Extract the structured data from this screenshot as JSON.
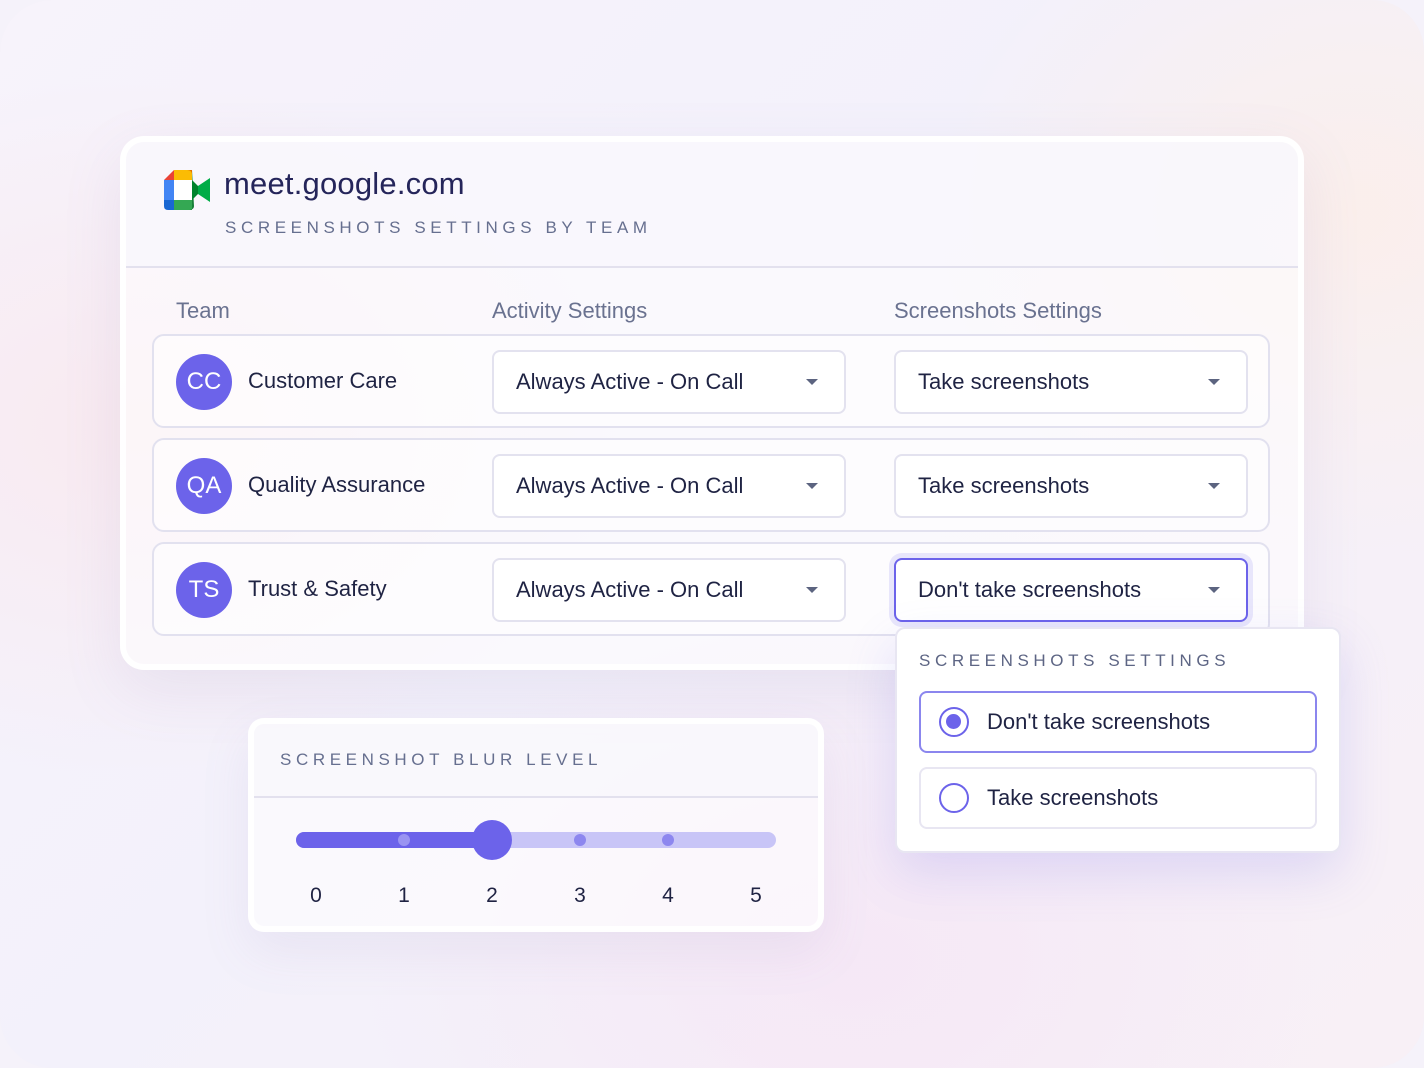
{
  "header": {
    "site": "meet.google.com",
    "subtitle": "SCREENSHOTS SETTINGS BY TEAM",
    "logo_icon": "google-meet-icon"
  },
  "columns": {
    "team": "Team",
    "activity": "Activity Settings",
    "screenshots": "Screenshots Settings"
  },
  "rows": [
    {
      "initials": "CC",
      "name": "Customer Care",
      "activity": "Always Active - On Call",
      "screenshots": "Take screenshots"
    },
    {
      "initials": "QA",
      "name": "Quality Assurance",
      "activity": "Always Active - On Call",
      "screenshots": "Take screenshots"
    },
    {
      "initials": "TS",
      "name": "Trust & Safety",
      "activity": "Always Active - On Call",
      "screenshots": "Don't take screenshots"
    }
  ],
  "dropdown": {
    "title": "SCREENSHOTS SETTINGS",
    "options": [
      {
        "label": "Don't take screenshots",
        "selected": true
      },
      {
        "label": "Take screenshots",
        "selected": false
      }
    ]
  },
  "blur": {
    "title": "SCREENSHOT BLUR LEVEL",
    "levels": [
      "0",
      "1",
      "2",
      "3",
      "4",
      "5"
    ],
    "value": 2,
    "min": 0,
    "max": 5
  },
  "colors": {
    "accent": "#6c63ea",
    "accent_light": "#c8c5f7",
    "text": "#1f2343",
    "muted": "#6a7290"
  }
}
